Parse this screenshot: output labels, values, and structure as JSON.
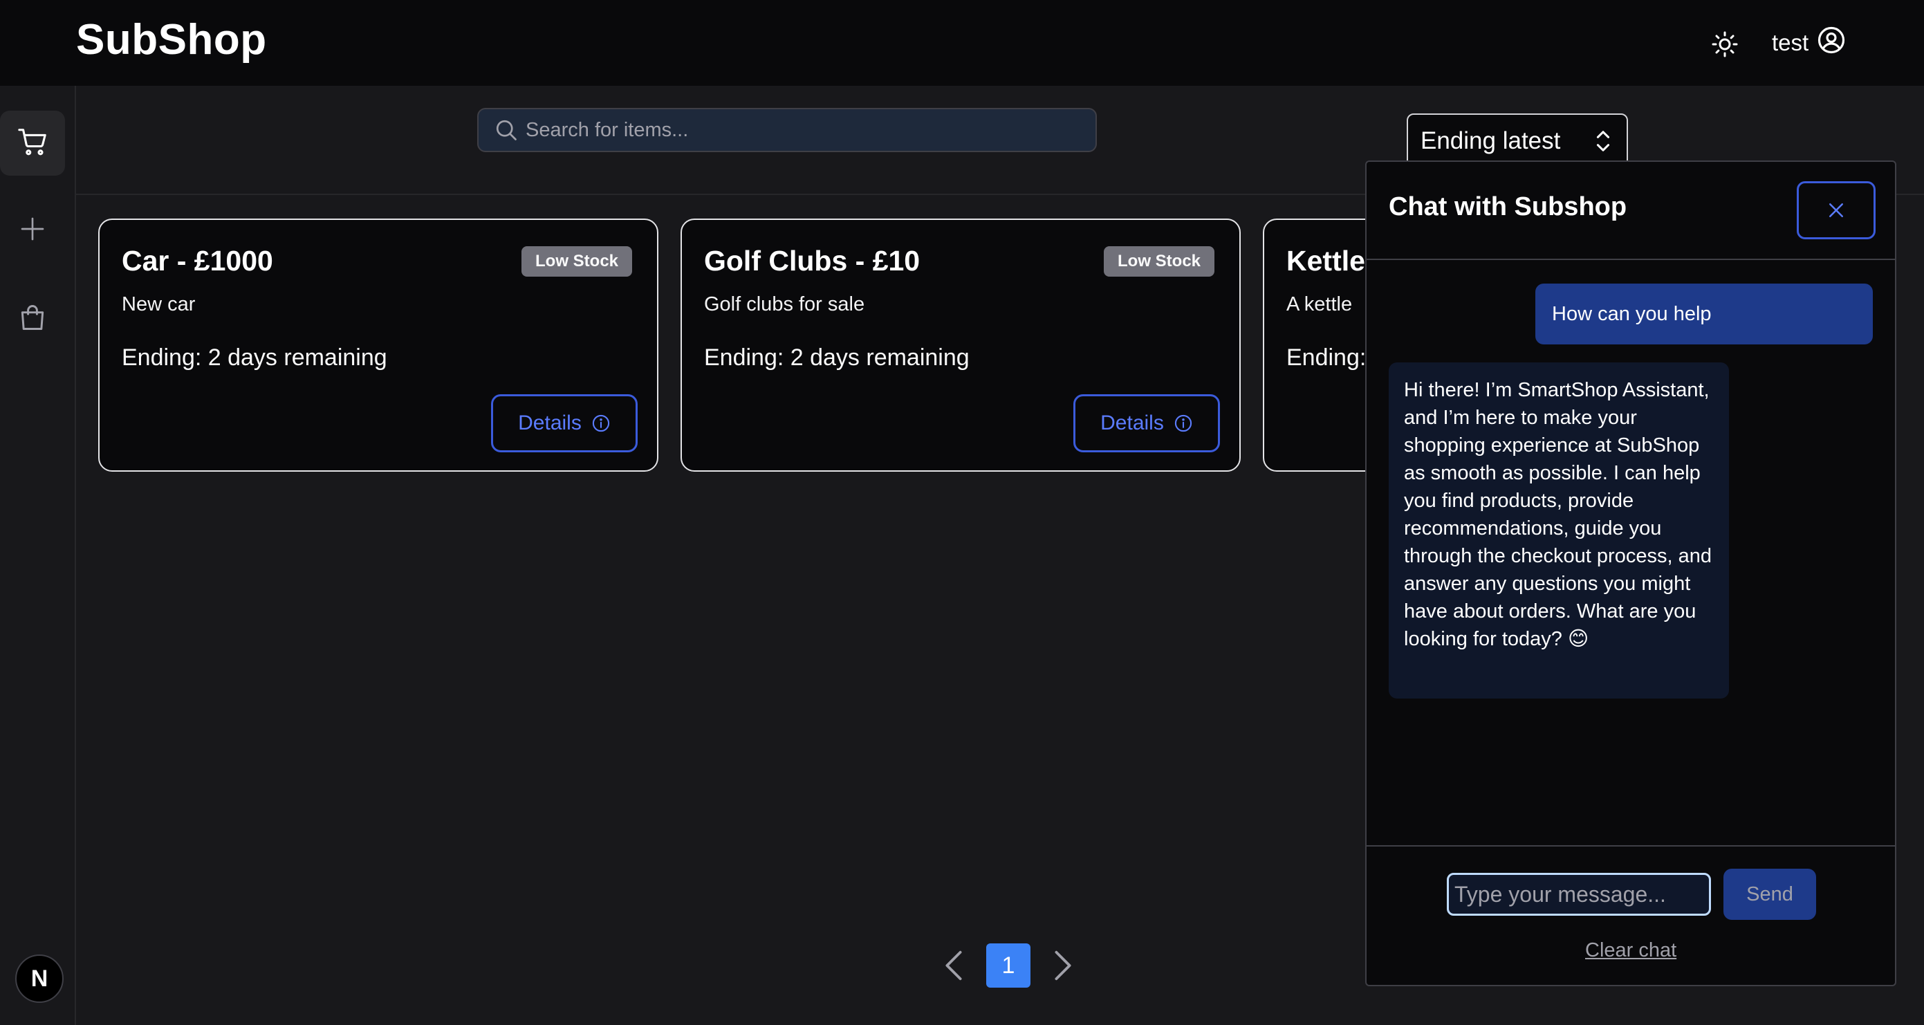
{
  "header": {
    "logo": "SubShop",
    "username": "test"
  },
  "search": {
    "placeholder": "Search for items..."
  },
  "sort": {
    "selected": "Ending latest"
  },
  "cards": [
    {
      "title": "Car - £1000",
      "description": "New car",
      "ending": "Ending: 2 days remaining",
      "badge": "Low Stock",
      "details_label": "Details"
    },
    {
      "title": "Golf Clubs - £10",
      "description": "Golf clubs for sale",
      "ending": "Ending: 2 days remaining",
      "badge": "Low Stock",
      "details_label": "Details"
    },
    {
      "title": "Kettle",
      "description": "A kettle",
      "ending": "Ending:"
    }
  ],
  "pagination": {
    "current": "1"
  },
  "chat": {
    "title": "Chat with Subshop",
    "messages": [
      {
        "role": "user",
        "text": "How can you help"
      },
      {
        "role": "assistant",
        "text": "Hi there! I’m SmartShop Assistant, and I’m here to make your shopping experience at SubShop as smooth as possible. I can help you find products, provide recommendations, guide you through the checkout process, and answer any questions you might have about orders. What are you looking for today? 😊"
      }
    ],
    "input_placeholder": "Type your message...",
    "send_label": "Send",
    "clear_label": "Clear chat"
  },
  "sidebar": {
    "badge_letter": "N"
  },
  "colors": {
    "accent": "#3b82f6",
    "outline_button": "#3b5bdb",
    "user_bubble": "#1e3a8a",
    "bot_bubble": "#0f172a"
  }
}
